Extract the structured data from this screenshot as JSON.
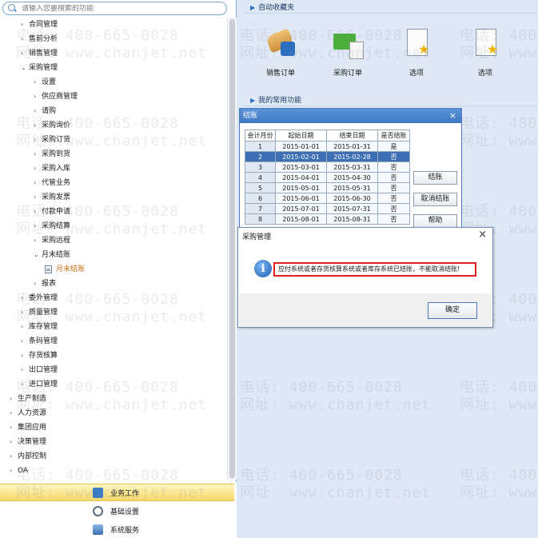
{
  "search": {
    "placeholder": "请输入您要搜索的功能"
  },
  "tree": [
    {
      "label": "合同管理",
      "level": 2,
      "expanded": false
    },
    {
      "label": "售前分析",
      "level": 2,
      "expanded": false
    },
    {
      "label": "销售管理",
      "level": 2,
      "expanded": false
    },
    {
      "label": "采购管理",
      "level": 2,
      "expanded": true
    },
    {
      "label": "设置",
      "level": 3,
      "expanded": false
    },
    {
      "label": "供应商管理",
      "level": 3,
      "expanded": false
    },
    {
      "label": "请购",
      "level": 3,
      "expanded": false
    },
    {
      "label": "采购询价",
      "level": 3,
      "expanded": false
    },
    {
      "label": "采购订货",
      "level": 3,
      "expanded": false
    },
    {
      "label": "采购到货",
      "level": 3,
      "expanded": false
    },
    {
      "label": "采购入库",
      "level": 3,
      "expanded": false
    },
    {
      "label": "代管业务",
      "level": 3,
      "expanded": false
    },
    {
      "label": "采购发票",
      "level": 3,
      "expanded": false
    },
    {
      "label": "付款申请",
      "level": 3,
      "expanded": false
    },
    {
      "label": "采购结算",
      "level": 3,
      "expanded": false
    },
    {
      "label": "采购远程",
      "level": 3,
      "expanded": false
    },
    {
      "label": "月末结账",
      "level": 3,
      "expanded": true
    },
    {
      "label": "月末结账",
      "level": 4,
      "leaf": true,
      "active": true
    },
    {
      "label": "报表",
      "level": 3,
      "expanded": false
    },
    {
      "label": "委外管理",
      "level": 2,
      "expanded": false
    },
    {
      "label": "质量管理",
      "level": 2,
      "expanded": false
    },
    {
      "label": "库存管理",
      "level": 2,
      "expanded": false
    },
    {
      "label": "条码管理",
      "level": 2,
      "expanded": false
    },
    {
      "label": "存货核算",
      "level": 2,
      "expanded": false
    },
    {
      "label": "出口管理",
      "level": 2,
      "expanded": false
    },
    {
      "label": "进口管理",
      "level": 2,
      "expanded": false
    },
    {
      "label": "生产制造",
      "level": 1,
      "expanded": false
    },
    {
      "label": "人力资源",
      "level": 1,
      "expanded": false
    },
    {
      "label": "集团应用",
      "level": 1,
      "expanded": false
    },
    {
      "label": "决策管理",
      "level": 1,
      "expanded": false
    },
    {
      "label": "内部控制",
      "level": 1,
      "expanded": false
    },
    {
      "label": "OA",
      "level": 1,
      "expanded": false
    }
  ],
  "bottom_nav": [
    {
      "label": "业务工作",
      "icon": "business-work-icon",
      "active": true
    },
    {
      "label": "基础设置",
      "icon": "gear-icon",
      "active": false
    },
    {
      "label": "系统服务",
      "icon": "system-service-icon",
      "active": false
    }
  ],
  "favorites": {
    "title": "自动收藏夹",
    "items": [
      {
        "label": "销售订单",
        "icon": "sales-order-icon"
      },
      {
        "label": "采购订单",
        "icon": "purchase-order-icon"
      },
      {
        "label": "选项",
        "icon": "options-icon"
      },
      {
        "label": "选项",
        "icon": "options-icon"
      }
    ]
  },
  "common": {
    "title": "我的常用功能"
  },
  "watermark": {
    "phone": "电话: 400-665-0028",
    "site": "网址: www.chanjet.net"
  },
  "settle_dialog": {
    "title": "结账",
    "close": "×",
    "columns": [
      "会计月份",
      "起始日期",
      "结束日期",
      "是否结账"
    ],
    "rows": [
      {
        "month": "1",
        "start": "2015-01-01",
        "end": "2015-01-31",
        "closed": "是"
      },
      {
        "month": "2",
        "start": "2015-02-01",
        "end": "2015-02-28",
        "closed": "否",
        "selected": true
      },
      {
        "month": "3",
        "start": "2015-03-01",
        "end": "2015-03-31",
        "closed": "否"
      },
      {
        "month": "4",
        "start": "2015-04-01",
        "end": "2015-04-30",
        "closed": "否"
      },
      {
        "month": "5",
        "start": "2015-05-01",
        "end": "2015-05-31",
        "closed": "否"
      },
      {
        "month": "6",
        "start": "2015-06-01",
        "end": "2015-06-30",
        "closed": "否"
      },
      {
        "month": "7",
        "start": "2015-07-01",
        "end": "2015-07-31",
        "closed": "否"
      },
      {
        "month": "8",
        "start": "2015-08-01",
        "end": "2015-08-31",
        "closed": "否"
      }
    ],
    "buttons": {
      "settle": "结账",
      "cancel": "取消结账",
      "help": "帮助"
    }
  },
  "message_box": {
    "title": "采购管理",
    "close": "×",
    "text": "应付系统或者存货核算系统或者库存系统已结账，不能取消结账!",
    "ok": "确定",
    "accent": "#e02020"
  },
  "colors": {
    "accent": "#3d6fb5",
    "active_tree": "#c86a12",
    "nav_active": "#f6d86a"
  }
}
